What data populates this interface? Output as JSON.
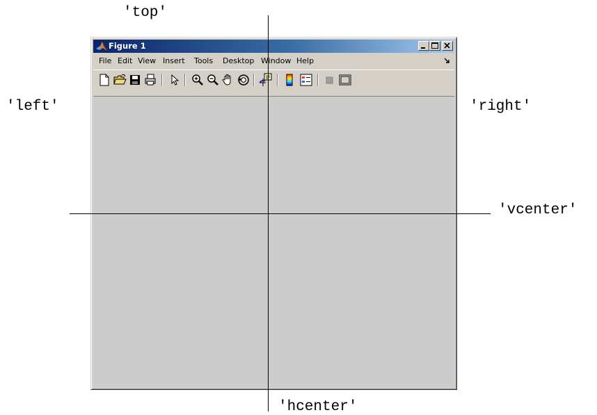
{
  "annotations": {
    "top": "'top'",
    "left": "'left'",
    "right": "'right'",
    "vcenter": "'vcenter'",
    "hcenter": "'hcenter'"
  },
  "window": {
    "title": "Figure 1",
    "icon": "matlab-logo-icon",
    "controls": [
      "minimize-icon",
      "maximize-icon",
      "close-icon"
    ]
  },
  "menu": {
    "items": [
      "File",
      "Edit",
      "View",
      "Insert",
      "Tools",
      "Desktop",
      "Window",
      "Help"
    ],
    "dock_icon": "dock-arrow-icon"
  },
  "toolbar": {
    "tools": [
      "new-figure-icon",
      "open-file-icon",
      "save-icon",
      "print-icon",
      "edit-plot-arrow-icon",
      "zoom-in-icon",
      "zoom-out-icon",
      "pan-hand-icon",
      "rotate-3d-icon",
      "data-cursor-icon",
      "colorbar-icon",
      "legend-icon",
      "hide-plot-tools-icon",
      "show-plot-tools-icon"
    ]
  },
  "colors": {
    "title_gradient_start": "#0a246a",
    "title_gradient_end": "#a6caf0",
    "window_face": "#d4d0c8",
    "canvas": "#cccccc"
  }
}
